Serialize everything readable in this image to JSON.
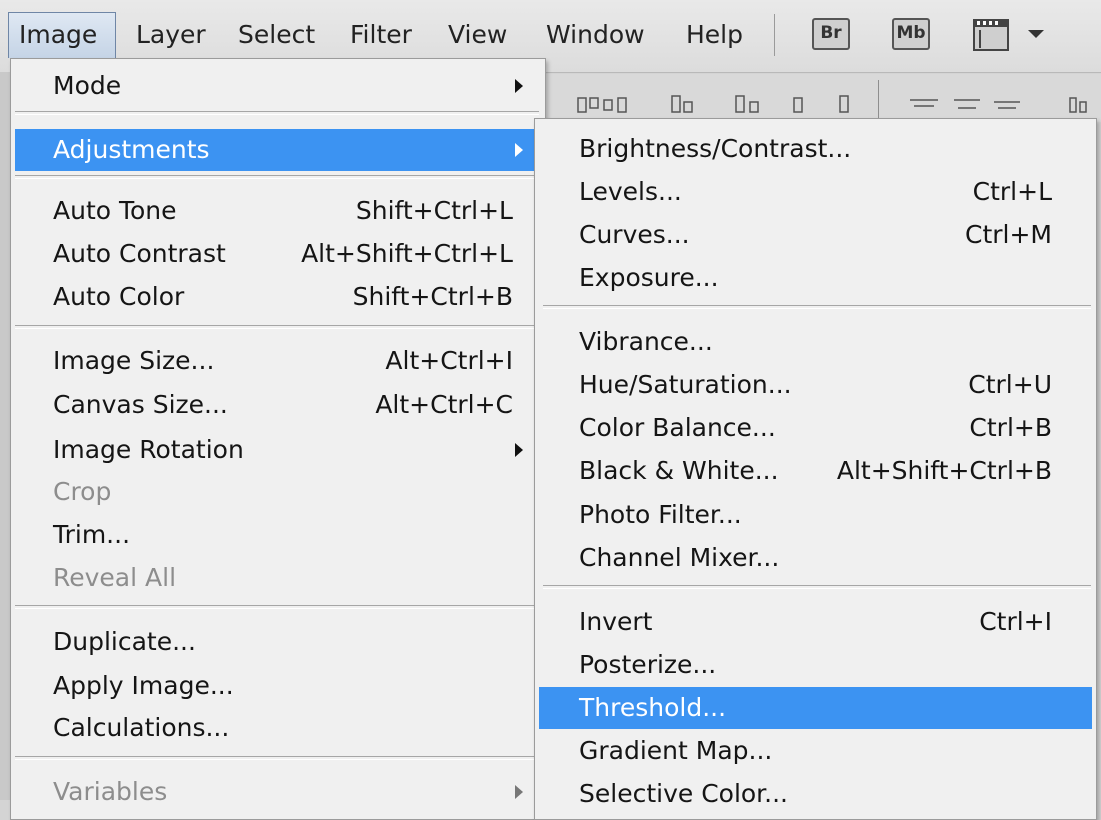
{
  "menubar": {
    "items": [
      {
        "label": "Image",
        "active": true
      },
      {
        "label": "Layer"
      },
      {
        "label": "Select"
      },
      {
        "label": "Filter"
      },
      {
        "label": "View"
      },
      {
        "label": "Window"
      },
      {
        "label": "Help"
      }
    ],
    "bridge_label": "Br",
    "minibridge_label": "Mb",
    "layout_icon": "arrange-documents-icon"
  },
  "image_menu": {
    "items": [
      {
        "label": "Mode",
        "submenu": true
      },
      {
        "label": "Adjustments",
        "submenu": true,
        "highlighted": true
      },
      {
        "label": "Auto Tone",
        "shortcut": "Shift+Ctrl+L"
      },
      {
        "label": "Auto Contrast",
        "shortcut": "Alt+Shift+Ctrl+L"
      },
      {
        "label": "Auto Color",
        "shortcut": "Shift+Ctrl+B"
      },
      {
        "label": "Image Size...",
        "shortcut": "Alt+Ctrl+I"
      },
      {
        "label": "Canvas Size...",
        "shortcut": "Alt+Ctrl+C"
      },
      {
        "label": "Image Rotation",
        "submenu": true
      },
      {
        "label": "Crop",
        "disabled": true
      },
      {
        "label": "Trim..."
      },
      {
        "label": "Reveal All",
        "disabled": true
      },
      {
        "label": "Duplicate..."
      },
      {
        "label": "Apply Image..."
      },
      {
        "label": "Calculations..."
      },
      {
        "label": "Variables",
        "submenu": true,
        "disabled": true
      }
    ]
  },
  "adjustments_menu": {
    "items": [
      {
        "label": "Brightness/Contrast..."
      },
      {
        "label": "Levels...",
        "shortcut": "Ctrl+L"
      },
      {
        "label": "Curves...",
        "shortcut": "Ctrl+M"
      },
      {
        "label": "Exposure..."
      },
      {
        "label": "Vibrance..."
      },
      {
        "label": "Hue/Saturation...",
        "shortcut": "Ctrl+U"
      },
      {
        "label": "Color Balance...",
        "shortcut": "Ctrl+B"
      },
      {
        "label": "Black & White...",
        "shortcut": "Alt+Shift+Ctrl+B"
      },
      {
        "label": "Photo Filter..."
      },
      {
        "label": "Channel Mixer..."
      },
      {
        "label": "Invert",
        "shortcut": "Ctrl+I"
      },
      {
        "label": "Posterize..."
      },
      {
        "label": "Threshold...",
        "highlighted": true
      },
      {
        "label": "Gradient Map..."
      },
      {
        "label": "Selective Color..."
      }
    ]
  },
  "colors": {
    "highlight": "#3c93f2",
    "menu_bg": "#f0f0f0",
    "disabled_text": "#8d8d8d"
  }
}
